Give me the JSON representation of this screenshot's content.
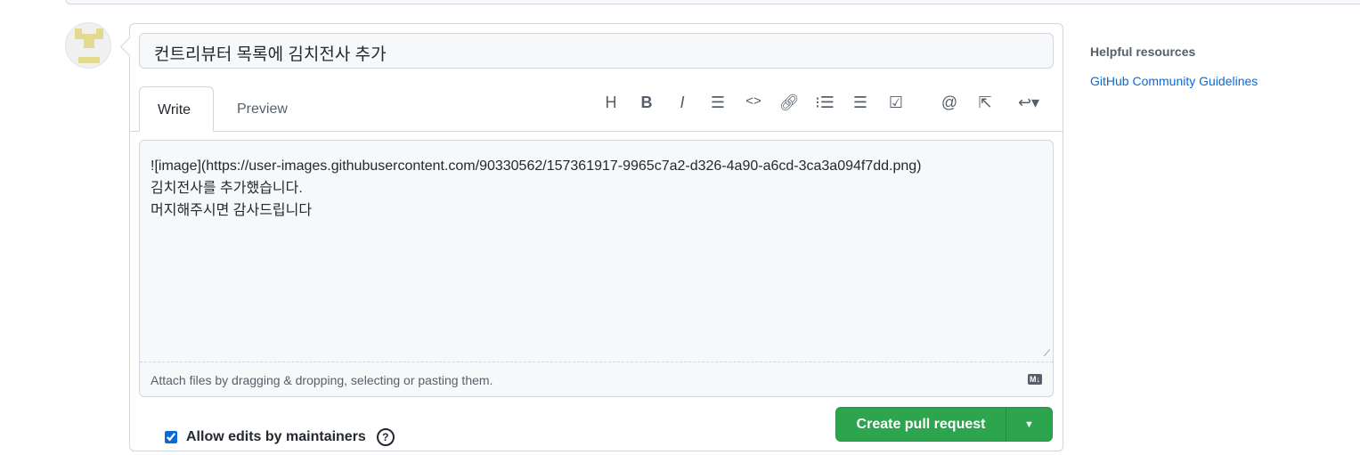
{
  "title_input": {
    "value": "컨트리뷰터 목록에 김치전사 추가"
  },
  "tabs": [
    {
      "label": "Write"
    },
    {
      "label": "Preview"
    }
  ],
  "toolbar": [
    "heading-icon",
    "bold-icon",
    "italic-icon",
    "quote-icon",
    "code-icon",
    "link-icon",
    "bulleted-list-icon",
    "numbered-list-icon",
    "task-list-icon",
    "mention-icon",
    "cross-reference-icon",
    "reply-icon"
  ],
  "editor": {
    "lines": [
      "![image](https://user-images.githubusercontent.com/90330562/157361917-9965c7a2-d326-4a90-a6cd-3ca3a094f7dd.png)",
      "김치전사를 추가했습니다.",
      "머지해주시면 감사드립니다"
    ],
    "footer": "Attach files by dragging & dropping, selecting or pasting them.",
    "markdown_badge": "M↓"
  },
  "allow_edits": {
    "label": "Allow edits by maintainers",
    "checked": true,
    "help": "?"
  },
  "submit": {
    "label": "Create pull request",
    "caret": "▼"
  },
  "sidebar": {
    "heading": "Helpful resources",
    "link": "GitHub Community Guidelines"
  }
}
